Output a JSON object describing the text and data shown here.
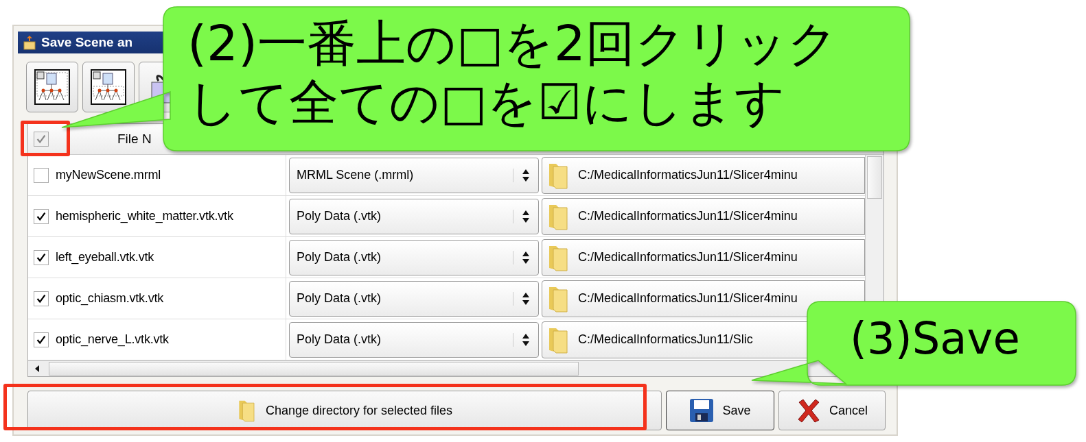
{
  "dialog": {
    "title": "Save Scene an",
    "toolbar": [
      {
        "kind": "select-all"
      },
      {
        "kind": "select-modified"
      },
      {
        "kind": "package"
      }
    ],
    "table": {
      "header": {
        "checked": true,
        "disabled": true,
        "column_1": "File N"
      },
      "rows": [
        {
          "checked": false,
          "file": "myNewScene.mrml",
          "format": "MRML Scene (.mrml)",
          "directory": "C:/MedicalInformaticsJun11/Slicer4minu"
        },
        {
          "checked": true,
          "file": "hemispheric_white_matter.vtk.vtk",
          "format": "Poly Data (.vtk)",
          "directory": "C:/MedicalInformaticsJun11/Slicer4minu"
        },
        {
          "checked": true,
          "file": "left_eyeball.vtk.vtk",
          "format": "Poly Data (.vtk)",
          "directory": "C:/MedicalInformaticsJun11/Slicer4minu"
        },
        {
          "checked": true,
          "file": "optic_chiasm.vtk.vtk",
          "format": "Poly Data (.vtk)",
          "directory": "C:/MedicalInformaticsJun11/Slicer4minu"
        },
        {
          "checked": true,
          "file": "optic_nerve_L.vtk.vtk",
          "format": "Poly Data (.vtk)",
          "directory": "C:/MedicalInformaticsJun11/Slic"
        }
      ]
    },
    "buttons": [
      {
        "kind": "folder",
        "label": "Change directory for selected files"
      },
      {
        "kind": "save",
        "label": "Save"
      },
      {
        "kind": "cancel",
        "label": "Cancel"
      }
    ]
  },
  "callouts": [
    {
      "kind": "top",
      "lines": [
        "(2)一番上の□を2回クリック",
        "して全ての□を☑にします"
      ]
    },
    {
      "kind": "bottom",
      "lines": [
        "(3)Save"
      ]
    }
  ]
}
